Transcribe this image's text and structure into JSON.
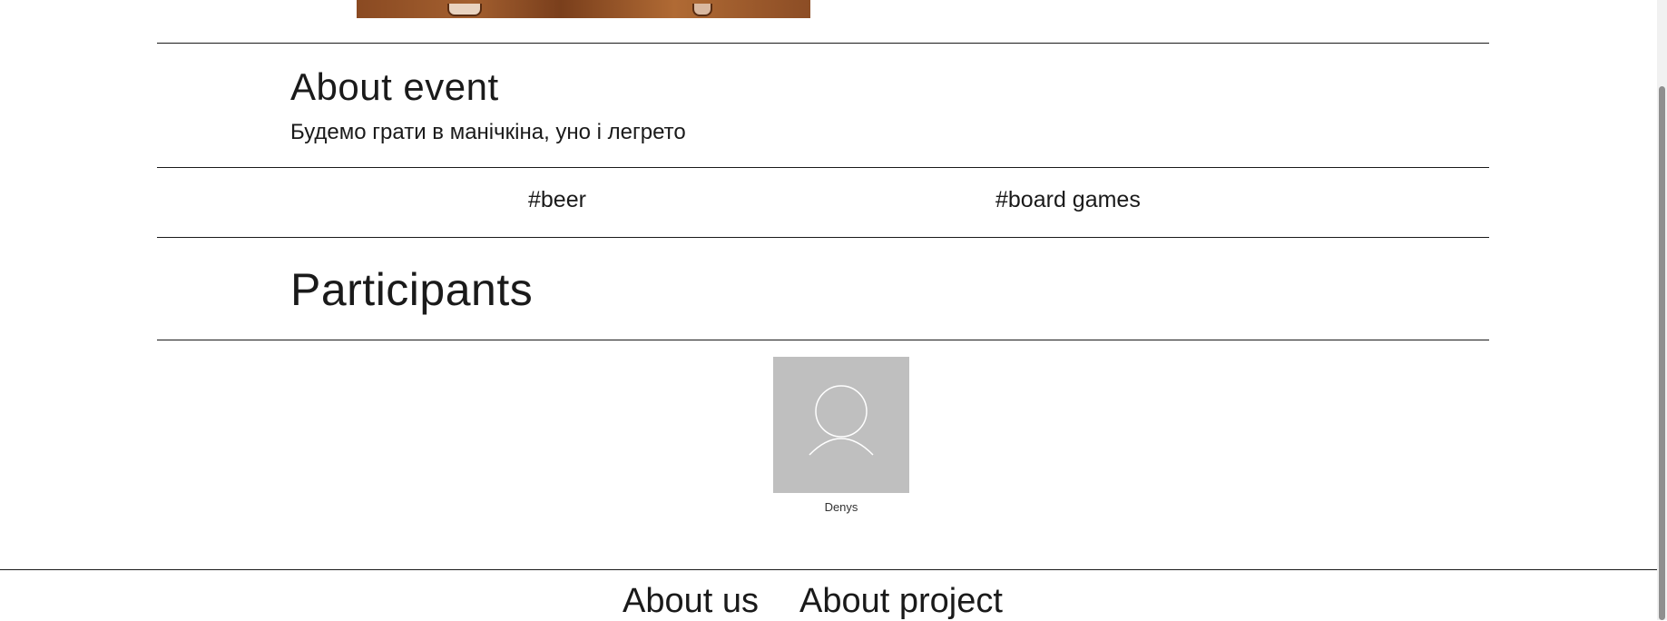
{
  "about": {
    "title": "About event",
    "description": "Будемо грати в манічкіна, уно і легрето"
  },
  "tags": [
    "#beer",
    "#board games"
  ],
  "participants": {
    "title": "Participants",
    "list": [
      {
        "name": "Denys"
      }
    ]
  },
  "footer": {
    "links": [
      "About us",
      "About project"
    ]
  },
  "colors": {
    "line": "#1a1a1a",
    "avatar_bg": "#bfbfbf",
    "event_image": "#8a4a22"
  }
}
